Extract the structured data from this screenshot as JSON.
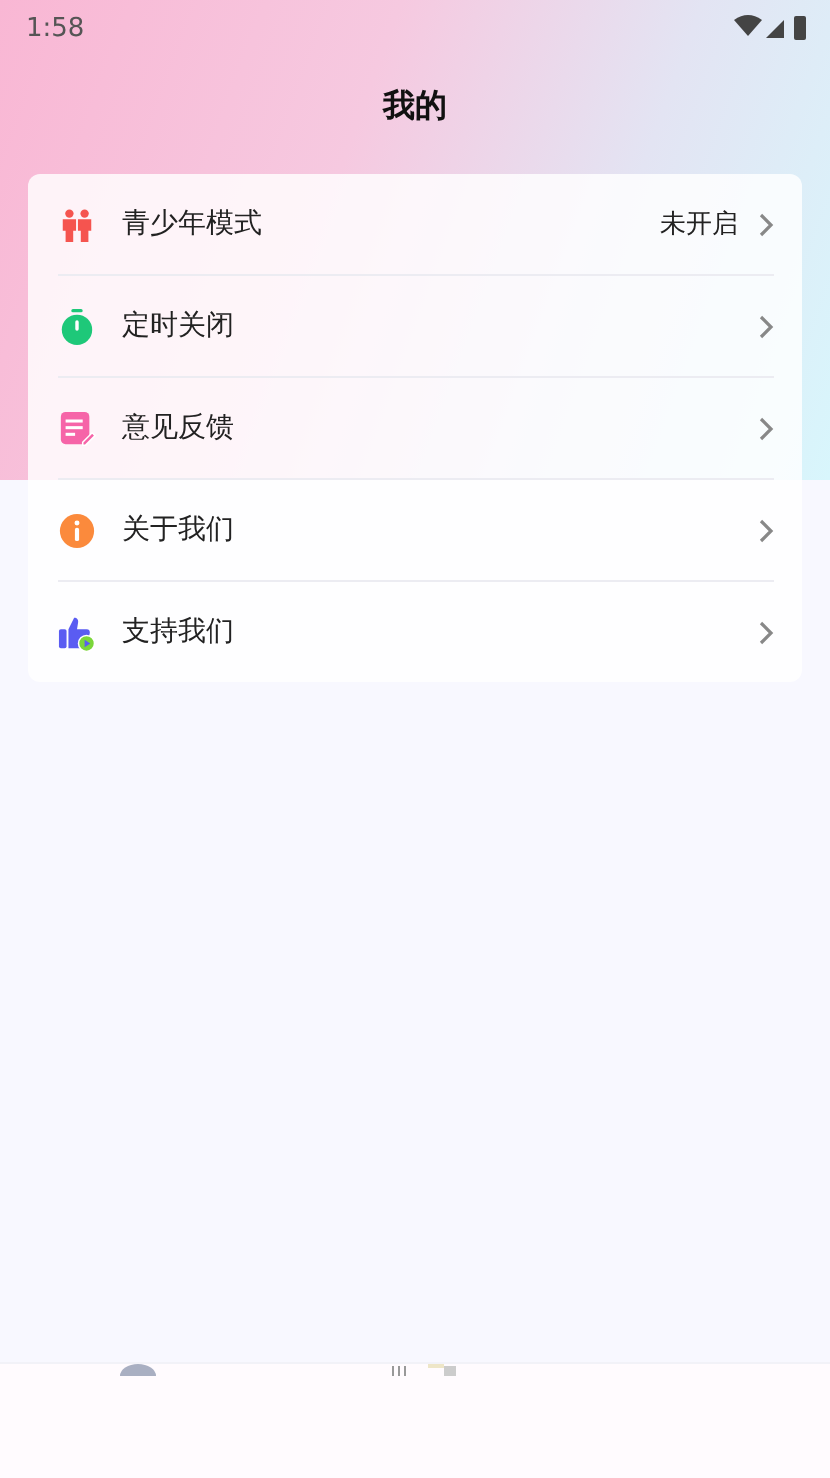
{
  "status_bar": {
    "time": "1:58"
  },
  "header": {
    "title": "我的"
  },
  "menu": [
    {
      "kind": "people",
      "label": "青少年模式",
      "value": "未开启"
    },
    {
      "kind": "timer",
      "label": "定时关闭"
    },
    {
      "kind": "note",
      "label": "意见反馈"
    },
    {
      "kind": "info",
      "label": "关于我们"
    },
    {
      "kind": "thumb",
      "label": "支持我们"
    }
  ]
}
